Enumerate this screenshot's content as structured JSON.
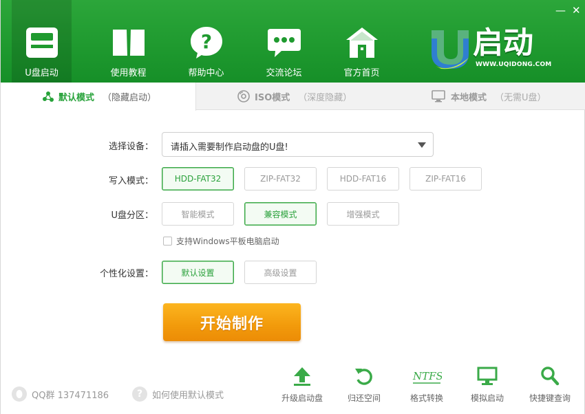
{
  "nav": [
    {
      "label": "U盘启动",
      "icon": "usb-drive-icon",
      "active": true
    },
    {
      "label": "使用教程",
      "icon": "book-icon"
    },
    {
      "label": "帮助中心",
      "icon": "help-bubble-icon"
    },
    {
      "label": "交流论坛",
      "icon": "chat-bubble-icon"
    },
    {
      "label": "官方首页",
      "icon": "home-icon"
    }
  ],
  "window": {
    "minimize": "—",
    "close": "✕"
  },
  "logo": {
    "text": "启动",
    "letter": "U",
    "site": "WWW.UQIDONG.COM"
  },
  "tabs": [
    {
      "label": "默认模式",
      "sub": "（隐藏启动）",
      "icon": "share-nodes-icon",
      "active": true
    },
    {
      "label": "ISO模式",
      "sub": "（深度隐藏）",
      "icon": "disc-icon"
    },
    {
      "label": "本地模式",
      "sub": "（无需U盘）",
      "icon": "monitor-icon"
    }
  ],
  "form": {
    "device_label": "选择设备：",
    "device_value": "请插入需要制作启动盘的U盘!",
    "write_label": "写入模式：",
    "write_options": [
      "HDD-FAT32",
      "ZIP-FAT32",
      "HDD-FAT16",
      "ZIP-FAT16"
    ],
    "write_selected": 0,
    "partition_label": "U盘分区：",
    "partition_options": [
      "智能模式",
      "兼容模式",
      "增强模式"
    ],
    "partition_selected": 1,
    "tablet_checkbox": "支持Windows平板电脑启动",
    "tablet_checked": false,
    "custom_label": "个性化设置：",
    "custom_options": [
      "默认设置",
      "高级设置"
    ],
    "custom_selected": 0,
    "start_button": "开始制作"
  },
  "footer": {
    "qq": "QQ群 137471186",
    "howto": "如何使用默认模式",
    "tools": [
      {
        "label": "升级启动盘",
        "icon": "upload-arrow-icon"
      },
      {
        "label": "归还空间",
        "icon": "restore-icon"
      },
      {
        "label": "格式转换",
        "icon": "ntfs-icon",
        "icon_text": "NTFS"
      },
      {
        "label": "模拟启动",
        "icon": "monitor-icon"
      },
      {
        "label": "快捷键查询",
        "icon": "search-icon"
      }
    ]
  },
  "colors": {
    "brand_green": "#1f9a2f",
    "accent_orange": "#f29a0b",
    "selected_green": "#2aa13b"
  }
}
